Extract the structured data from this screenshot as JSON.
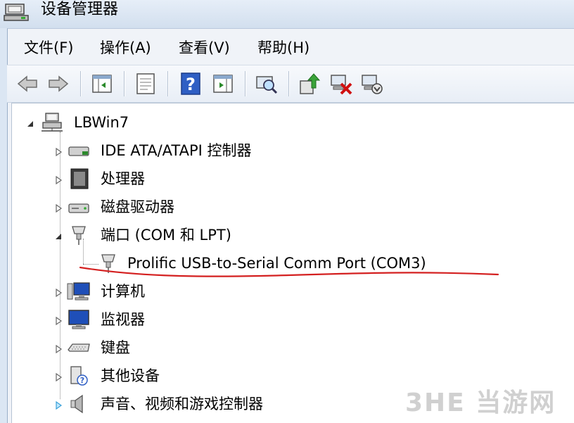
{
  "window": {
    "title": "设备管理器",
    "icon": "device-manager-icon"
  },
  "menubar": [
    {
      "label": "文件(F)"
    },
    {
      "label": "操作(A)"
    },
    {
      "label": "查看(V)"
    },
    {
      "label": "帮助(H)"
    }
  ],
  "toolbar": [
    {
      "icon": "back-arrow-icon"
    },
    {
      "icon": "forward-arrow-icon"
    },
    {
      "icon": "show-hide-console-tree-icon"
    },
    {
      "icon": "properties-icon"
    },
    {
      "icon": "help-icon"
    },
    {
      "icon": "action-pane-icon"
    },
    {
      "icon": "scan-hardware-icon"
    },
    {
      "icon": "update-driver-icon"
    },
    {
      "icon": "uninstall-device-icon"
    },
    {
      "icon": "disable-device-icon"
    }
  ],
  "tree": {
    "root": {
      "label": "LBWin7",
      "icon": "computer-network-icon",
      "expanded": true
    },
    "items": [
      {
        "label": "IDE ATA/ATAPI 控制器",
        "icon": "ide-controller-icon",
        "expanded": false
      },
      {
        "label": "处理器",
        "icon": "processor-icon",
        "expanded": false
      },
      {
        "label": "磁盘驱动器",
        "icon": "disk-drive-icon",
        "expanded": false
      },
      {
        "label": "端口 (COM 和 LPT)",
        "icon": "port-icon",
        "expanded": true,
        "children": [
          {
            "label": "Prolific USB-to-Serial Comm Port (COM3)",
            "icon": "serial-port-icon"
          }
        ]
      },
      {
        "label": "计算机",
        "icon": "computer-icon",
        "expanded": false
      },
      {
        "label": "监视器",
        "icon": "monitor-icon",
        "expanded": false
      },
      {
        "label": "键盘",
        "icon": "keyboard-icon",
        "expanded": false
      },
      {
        "label": "其他设备",
        "icon": "unknown-device-icon",
        "expanded": false
      },
      {
        "label": "声音、视频和游戏控制器",
        "icon": "speaker-icon",
        "expanded": false
      }
    ]
  },
  "annotation": {
    "color": "#d42020"
  },
  "watermark": {
    "text": "3HE 当游网"
  }
}
